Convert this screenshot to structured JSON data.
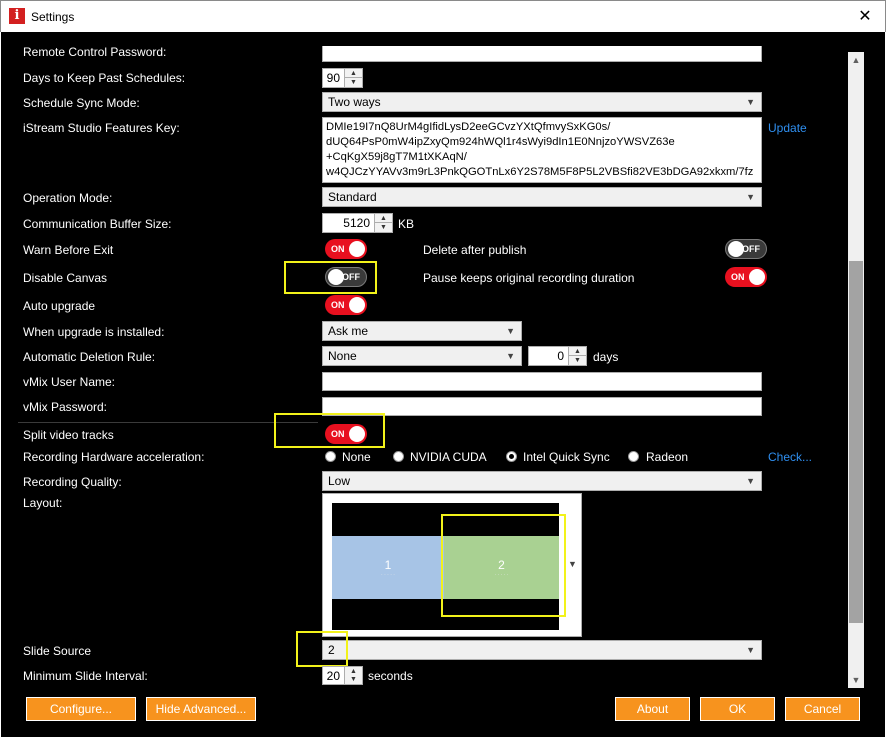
{
  "window": {
    "title": "Settings",
    "app_icon": "i",
    "close_glyph": "✕"
  },
  "fields": {
    "remote_password": {
      "label": "Remote Control Password:",
      "value": ""
    },
    "days_keep": {
      "label": "Days to Keep Past Schedules:",
      "value": "90"
    },
    "sync_mode": {
      "label": "Schedule Sync Mode:",
      "value": "Two ways"
    },
    "features_key": {
      "label": "iStream Studio Features Key:",
      "lines": [
        "DMIe19I7nQ8UrM4gIfidLysD2eeGCvzYXtQfmvySxKG0s/",
        "dUQ64PsP0mW4ipZxyQm924hWQl1r4sWyi9dIn1E0NnjzoYWSVZ63e",
        "+CqKgX59j8gT7M1tXKAqN/",
        "w4QJCzYYAVv3m9rL3PnkQGOTnLx6Y2S78M5F8P5L2VBSfi82VE3bDGA92xkxm/7fz"
      ],
      "update_label": "Update"
    },
    "operation_mode": {
      "label": "Operation Mode:",
      "value": "Standard"
    },
    "buffer_size": {
      "label": "Communication Buffer Size:",
      "value": "5120",
      "unit": "KB"
    },
    "warn_exit": {
      "label": "Warn Before Exit",
      "state": "ON"
    },
    "delete_publish": {
      "label": "Delete after publish",
      "state": "OFF"
    },
    "disable_canvas": {
      "label": "Disable Canvas",
      "state": "OFF"
    },
    "pause_keeps": {
      "label": "Pause keeps original recording duration",
      "state": "ON"
    },
    "auto_upgrade": {
      "label": "Auto upgrade",
      "state": "ON"
    },
    "upgrade_installed": {
      "label": "When upgrade is installed:",
      "value": "Ask me"
    },
    "auto_deletion": {
      "label": "Automatic Deletion Rule:",
      "value": "None",
      "days_value": "0",
      "days_unit": "days"
    },
    "vmix_user": {
      "label": "vMix User Name:",
      "value": ""
    },
    "vmix_password": {
      "label": "vMix Password:",
      "value": ""
    },
    "split_tracks": {
      "label": "Split video tracks",
      "state": "ON"
    },
    "hw_accel": {
      "label": "Recording Hardware acceleration:",
      "options": [
        "None",
        "NVIDIA CUDA",
        "Intel Quick Sync",
        "Radeon"
      ],
      "selected": "Intel Quick Sync",
      "check_label": "Check..."
    },
    "recording_quality": {
      "label": "Recording Quality:",
      "value": "Low"
    },
    "layout": {
      "label": "Layout:",
      "pane1": "1",
      "pane2": "2"
    },
    "slide_source": {
      "label": "Slide Source",
      "value": "2"
    },
    "min_slide_interval": {
      "label": "Minimum Slide Interval:",
      "value": "20",
      "unit": "seconds"
    }
  },
  "buttons": {
    "configure": "Configure...",
    "hide_advanced": "Hide Advanced...",
    "about": "About",
    "ok": "OK",
    "cancel": "Cancel"
  },
  "colors": {
    "background": "#000000",
    "toggle_on": "#e8101f",
    "button_orange": "#f7931e",
    "link_blue": "#2f8ff0",
    "highlight_yellow": "#f2f21a"
  }
}
